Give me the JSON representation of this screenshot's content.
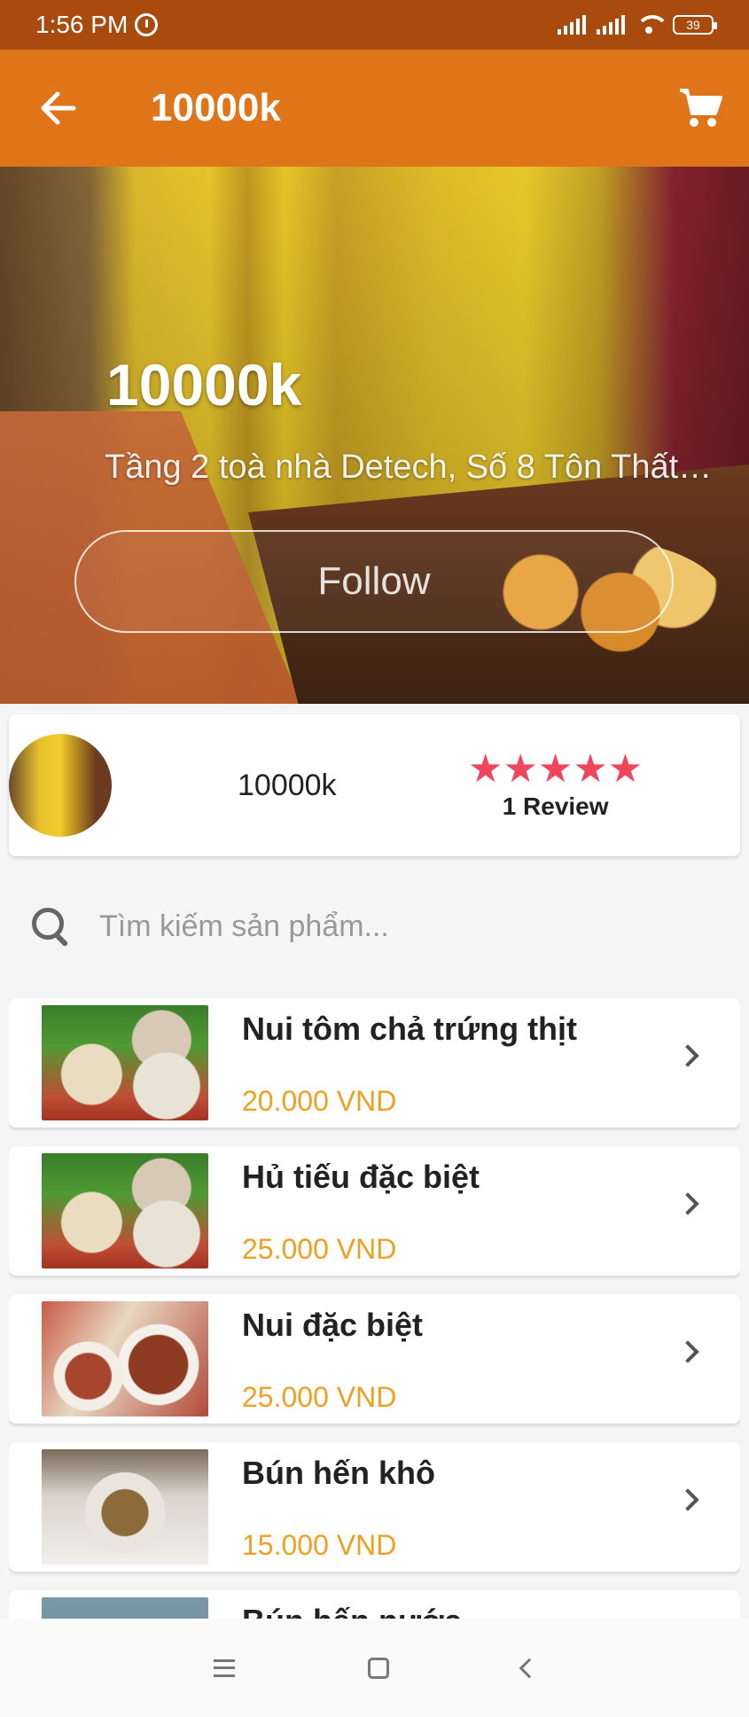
{
  "status_bar": {
    "time": "1:56 PM",
    "battery": "39"
  },
  "app_bar": {
    "title": "10000k"
  },
  "hero": {
    "title": "10000k",
    "address": "Tầng 2 toà nhà Detech, Số 8 Tôn Thất…",
    "follow_label": "Follow"
  },
  "shop": {
    "name": "10000k",
    "stars": "★★★★★",
    "rating": 5,
    "review_label": "1 Review"
  },
  "search": {
    "placeholder": "Tìm kiếm sản phẩm..."
  },
  "products": [
    {
      "name": "Nui  tôm chả trứng thịt",
      "price": "20.000 VND"
    },
    {
      "name": "Hủ tiếu đặc biệt",
      "price": "25.000 VND"
    },
    {
      "name": "Nui đặc biệt",
      "price": "25.000 VND"
    },
    {
      "name": "Bún hến khô",
      "price": "15.000 VND"
    },
    {
      "name": "Bún hến nước",
      "price": ""
    }
  ],
  "colors": {
    "status_bar": "#a94a0f",
    "app_bar": "#e07418",
    "star": "#f0455a",
    "price": "#f0a020"
  },
  "icons": {
    "back": "arrow-left",
    "cart": "shopping-cart",
    "search": "magnifier",
    "chevron": "chevron-right"
  }
}
